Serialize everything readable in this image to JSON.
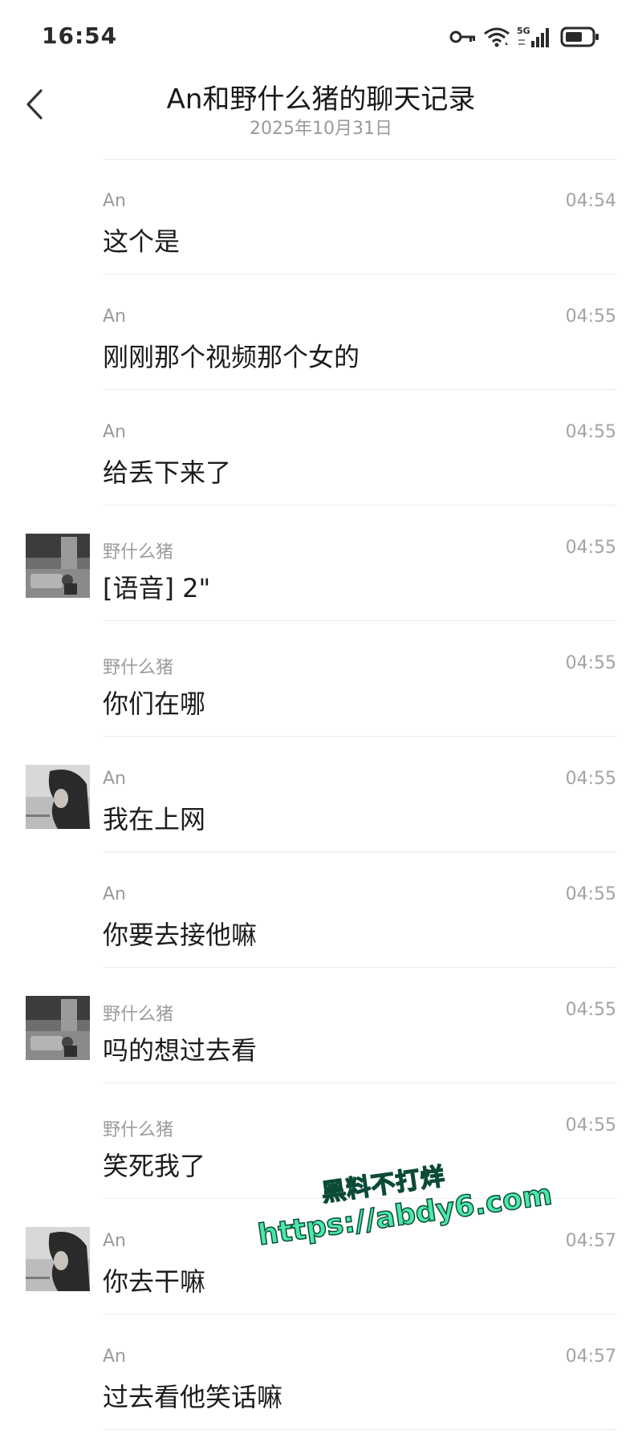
{
  "status_bar": {
    "time": "16:54",
    "network": "5G",
    "icons": [
      "key-icon",
      "wifi-icon",
      "signal-5g-icon",
      "battery-icon"
    ]
  },
  "header": {
    "title": "An和野什么猪的聊天记录",
    "date": "2025年10月31日",
    "back_icon": "chevron-left-icon"
  },
  "messages": [
    {
      "sender": "An",
      "time": "04:54",
      "text": "这个是",
      "avatar": false
    },
    {
      "sender": "An",
      "time": "04:55",
      "text": "刚刚那个视频那个女的",
      "avatar": false
    },
    {
      "sender": "An",
      "time": "04:55",
      "text": "给丢下来了",
      "avatar": false
    },
    {
      "sender": "野什么猪",
      "time": "04:55",
      "text": "[语音] 2\"",
      "avatar": true
    },
    {
      "sender": "野什么猪",
      "time": "04:55",
      "text": "你们在哪",
      "avatar": false
    },
    {
      "sender": "An",
      "time": "04:55",
      "text": "我在上网",
      "avatar": true
    },
    {
      "sender": "An",
      "time": "04:55",
      "text": "你要去接他嘛",
      "avatar": false
    },
    {
      "sender": "野什么猪",
      "time": "04:55",
      "text": "吗的想过去看",
      "avatar": true
    },
    {
      "sender": "野什么猪",
      "time": "04:55",
      "text": "笑死我了",
      "avatar": false
    },
    {
      "sender": "An",
      "time": "04:57",
      "text": "你去干嘛",
      "avatar": true
    },
    {
      "sender": "An",
      "time": "04:57",
      "text": "过去看他笑话嘛",
      "avatar": false
    }
  ],
  "watermark": {
    "line1": "黑料不打烊",
    "line2": "https://abdy6.com"
  },
  "colors": {
    "text_primary": "#1c1c1c",
    "text_secondary": "#9b9b9b",
    "divider": "#ececec",
    "watermark": "#4be8a8"
  }
}
